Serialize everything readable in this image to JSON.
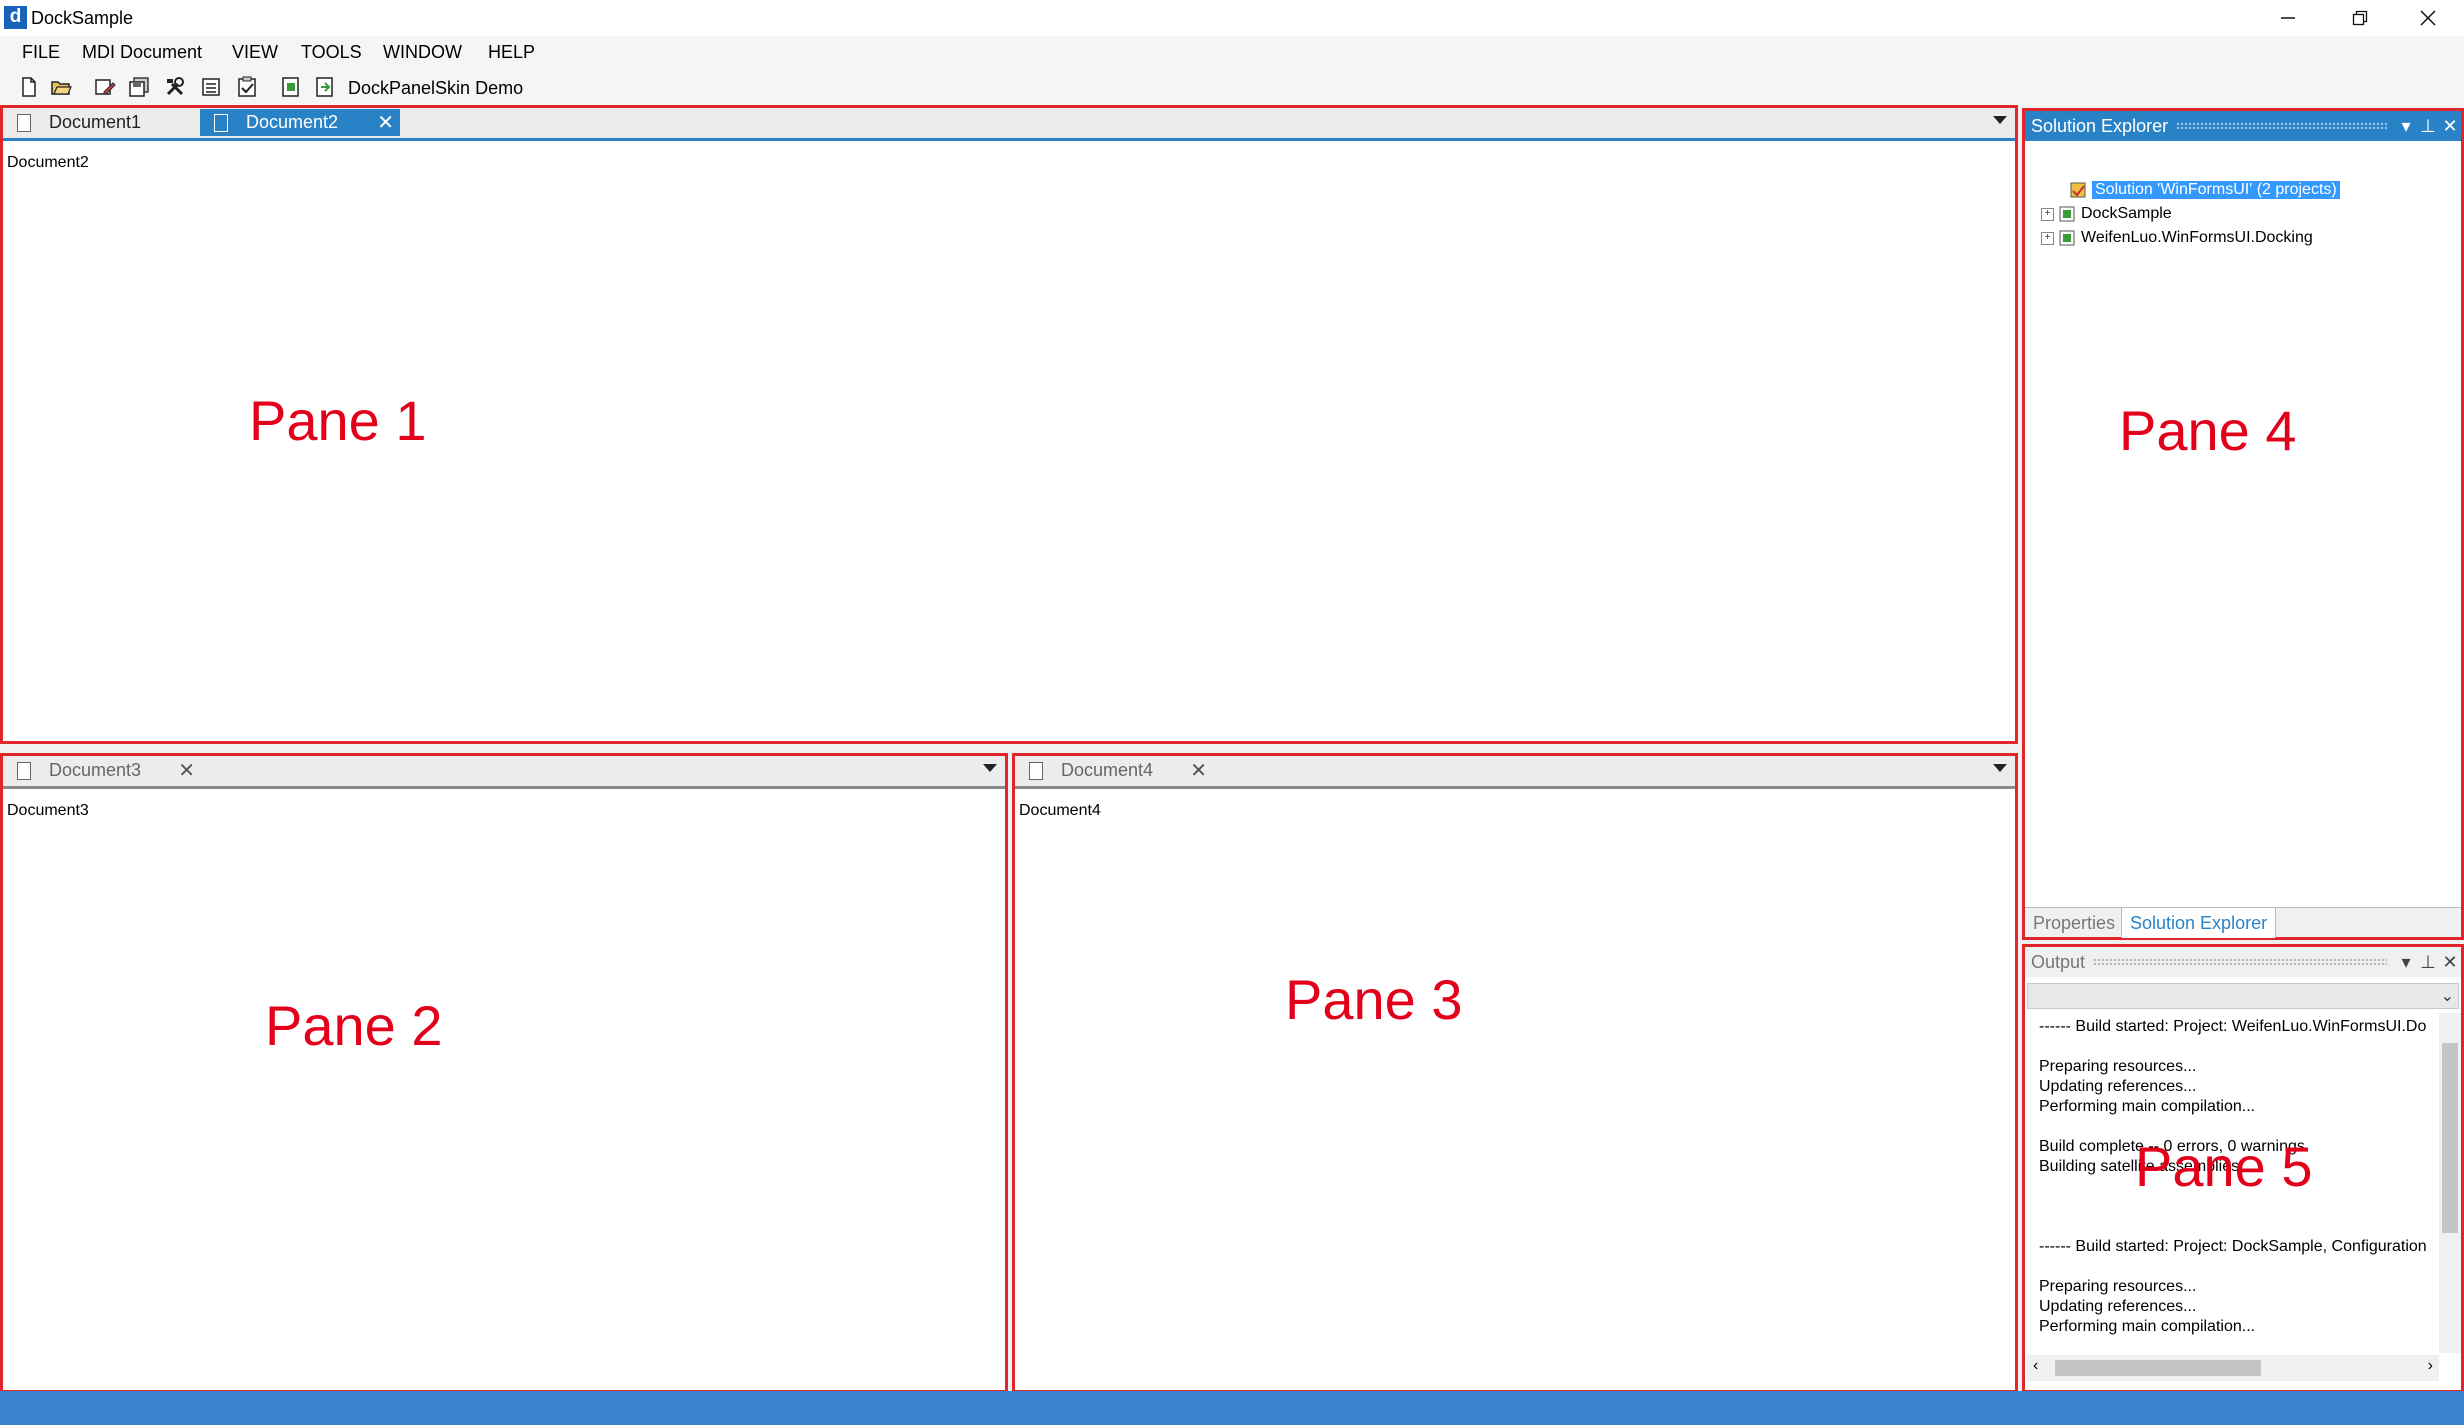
{
  "window": {
    "title": "DockSample",
    "app_icon_letter": "d"
  },
  "menu": [
    "FILE",
    "MDI Document",
    "VIEW",
    "TOOLS",
    "WINDOW",
    "HELP"
  ],
  "toolbar": {
    "label": "DockPanelSkin Demo",
    "icons": [
      "new-file-icon",
      "open-folder-icon",
      "edit-icon",
      "save-all-icon",
      "tools-icon",
      "list-icon",
      "checklist-icon",
      "export-icon",
      "import-icon"
    ]
  },
  "pane1": {
    "label": "Pane 1",
    "tabs": [
      "Document1",
      "Document2"
    ],
    "content": "Document2"
  },
  "pane2": {
    "label": "Pane 2",
    "tab": "Document3",
    "content": "Document3"
  },
  "pane3": {
    "label": "Pane 3",
    "tab": "Document4",
    "content": "Document4"
  },
  "pane4": {
    "label": "Pane 4",
    "title": "Solution Explorer",
    "tree": {
      "root": "Solution 'WinFormsUI' (2 projects)",
      "children": [
        "DockSample",
        "WeifenLuo.WinFormsUI.Docking"
      ]
    },
    "bottom_tabs": [
      "Properties",
      "Solution Explorer"
    ]
  },
  "pane5": {
    "label": "Pane 5",
    "title": "Output",
    "lines": [
      "------ Build started: Project: WeifenLuo.WinFormsUI.Do",
      "",
      "Preparing resources...",
      "Updating references...",
      "Performing main compilation...",
      "",
      "Build complete -- 0 errors, 0 warnings",
      "Building satellite assemblies...",
      "",
      "",
      "",
      "------ Build started: Project: DockSample, Configuration",
      "",
      "Preparing resources...",
      "Updating references...",
      "Performing main compilation..."
    ]
  },
  "colors": {
    "accent": "#2a82c6",
    "highlight": "#e0262a",
    "statusbar": "#3c80d0"
  }
}
